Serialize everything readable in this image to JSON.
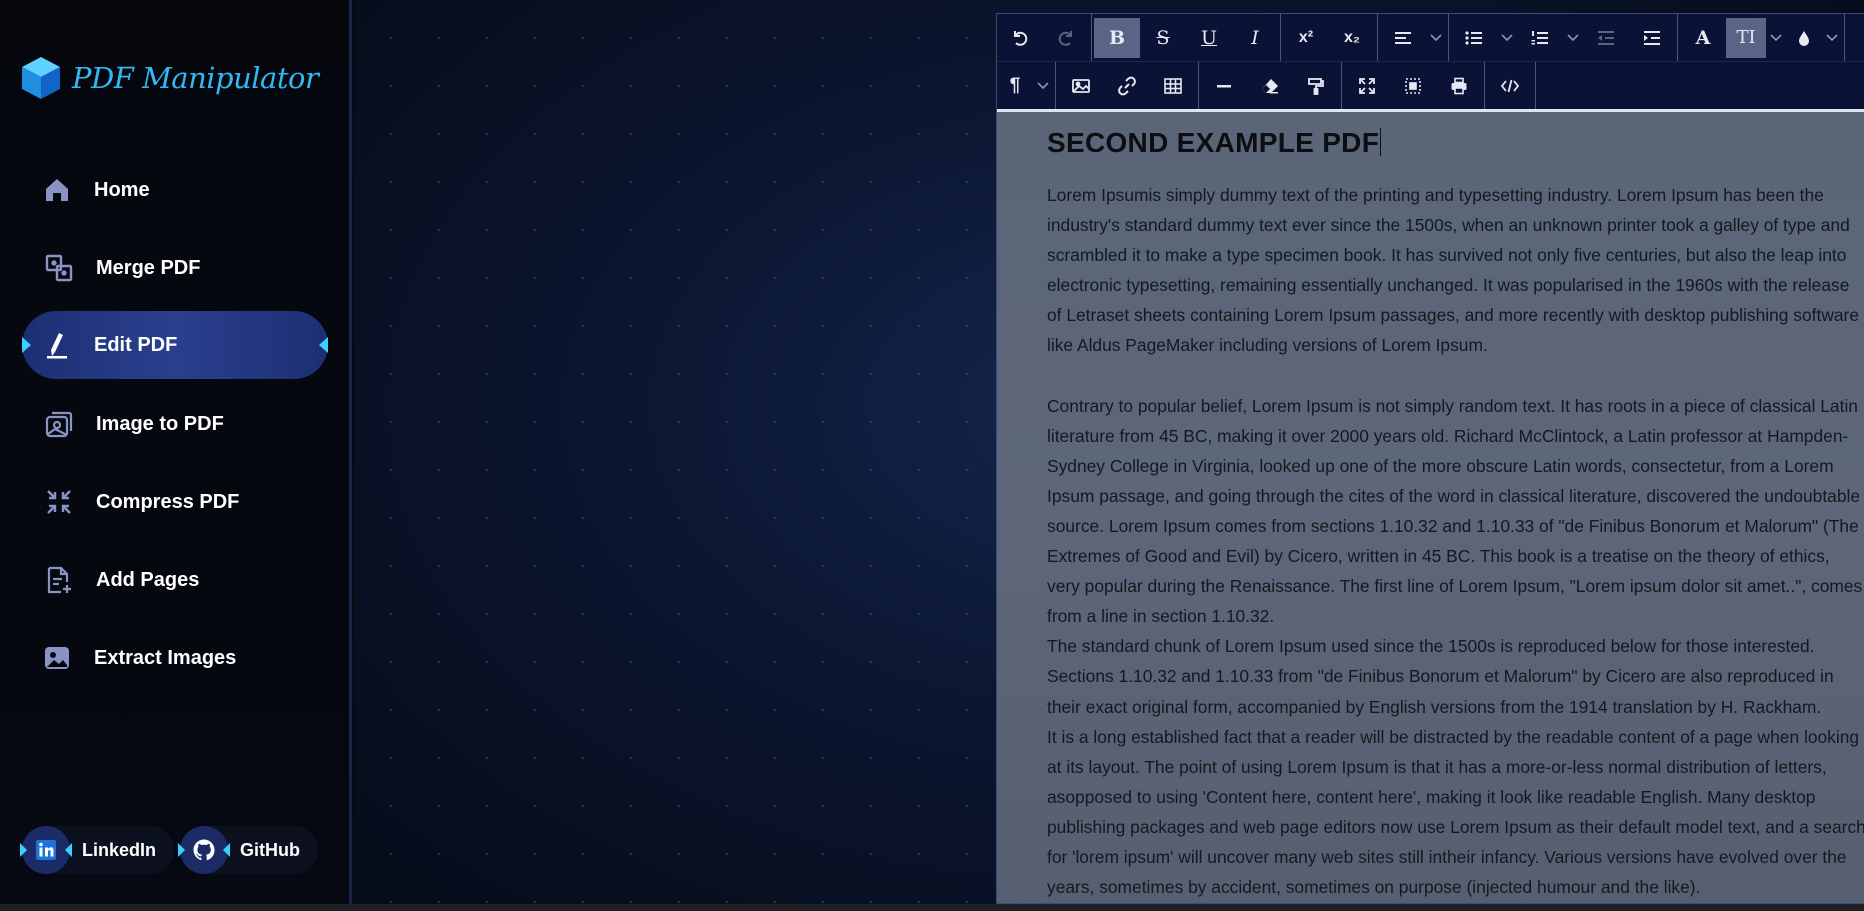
{
  "app": {
    "title": "PDF Manipulator"
  },
  "sidebar": {
    "items": [
      {
        "label": "Home",
        "icon": "home-icon"
      },
      {
        "label": "Merge PDF",
        "icon": "merge-icon"
      },
      {
        "label": "Edit PDF",
        "icon": "pen-icon",
        "active": true
      },
      {
        "label": "Image to PDF",
        "icon": "images-icon"
      },
      {
        "label": "Compress PDF",
        "icon": "compress-icon"
      },
      {
        "label": "Add Pages",
        "icon": "add-document-icon"
      },
      {
        "label": "Extract Images",
        "icon": "image-icon"
      }
    ],
    "social": [
      {
        "label": "LinkedIn",
        "icon": "linkedin-icon"
      },
      {
        "label": "GitHub",
        "icon": "github-icon"
      }
    ]
  },
  "colors": {
    "brand": "#33b8f2",
    "active_nav": "#2a3f8e",
    "toolbar_bg": "#0a1236",
    "page_bg": "#5a6577"
  },
  "toolbar": {
    "row1": [
      "undo-icon",
      "redo-icon",
      "bold-icon",
      "strikethrough-icon",
      "underline-icon",
      "italic-icon",
      "superscript-icon",
      "subscript-icon",
      "align-icon",
      "bulleted-list-icon",
      "numbered-list-icon",
      "outdent-icon",
      "indent-icon",
      "font-color-icon",
      "font-size-icon",
      "ink-drop-icon"
    ],
    "row2": [
      "paragraph-icon",
      "image-icon",
      "link-icon",
      "table-icon",
      "horizontal-rule-icon",
      "eraser-icon",
      "format-painter-icon",
      "fullscreen-icon",
      "select-all-icon",
      "print-icon",
      "source-code-icon"
    ],
    "labels": {
      "bold": "B",
      "strike": "S",
      "underline": "U",
      "italic": "I",
      "sup": "x²",
      "sub": "x₂",
      "font": "A",
      "size": "TI",
      "para": "¶"
    }
  },
  "document": {
    "title": "SECOND EXAMPLE PDF",
    "paragraphs": [
      "Lorem Ipsumis simply dummy text of the printing and typesetting industry. Lorem Ipsum has been the industry's standard dummy text ever since the 1500s, when an unknown printer took a galley of type and scrambled it to make a type specimen book. It has survived not only five centuries, but also the leap into electronic typesetting, remaining essentially unchanged. It was popularised in the 1960s with the release of Letraset sheets containing Lorem Ipsum passages, and more recently with desktop publishing software like Aldus PageMaker including versions of Lorem Ipsum.",
      "Contrary to popular belief, Lorem Ipsum is not simply random text. It has roots in a piece of classical Latin literature from 45 BC, making it over 2000 years old. Richard McClintock, a Latin professor at Hampden-Sydney College in Virginia, looked up one of the more obscure Latin words, consectetur, from a Lorem Ipsum passage, and going through the cites of the word in classical literature, discovered the undoubtable source. Lorem Ipsum comes from sections 1.10.32 and 1.10.33 of \"de Finibus Bonorum et Malorum\" (The Extremes of Good and Evil) by Cicero, written in 45 BC. This book is a treatise on the theory of ethics, very popular during the Renaissance. The first line of Lorem Ipsum, \"Lorem ipsum dolor sit amet..\", comes from a line in section 1.10.32.",
      "The standard chunk of Lorem Ipsum used since the 1500s is reproduced below for those interested. Sections 1.10.32 and 1.10.33 from \"de Finibus Bonorum et Malorum\" by Cicero are also reproduced in their exact original form, accompanied by English versions from the 1914 translation by H. Rackham.",
      "It is a long established fact that a reader will be distracted by the readable content of a page when looking at its layout. The point of using Lorem Ipsum is that it has a more-or-less normal distribution of letters, asopposed to using 'Content here, content here', making it look like readable English. Many desktop publishing packages and web page editors now use Lorem Ipsum as their default model text, and a search for 'lorem ipsum' will uncover many web sites still intheir infancy. Various versions have evolved over the years, sometimes by accident, sometimes on purpose (injected humour and the like)."
    ]
  }
}
